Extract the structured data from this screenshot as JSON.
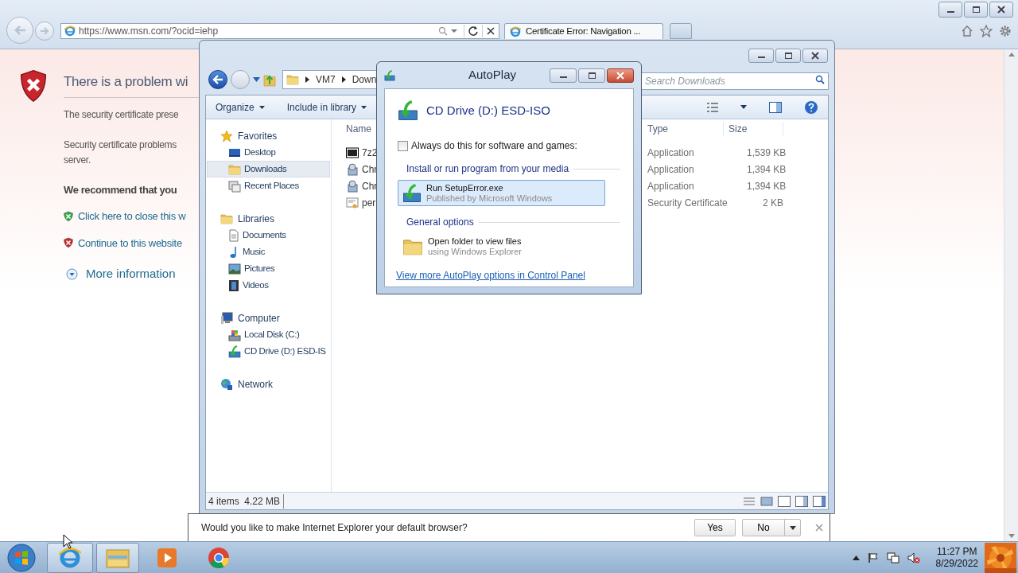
{
  "browser": {
    "address": "https://www.msn.com/?ocid=iehp",
    "tab_title": "Certificate Error: Navigation ...",
    "page": {
      "title": "There is a problem wi",
      "paragraphs": [
        {
          "lines": [
            "The security certificate prese"
          ]
        },
        {
          "lines": [
            "Security certificate problems",
            "server."
          ]
        }
      ],
      "recommend": "We recommend that you",
      "links": [
        {
          "kind": "safe",
          "text": "Click here to close this w"
        },
        {
          "kind": "unsafe",
          "text": "Continue to this website"
        }
      ],
      "more_info": "More information"
    },
    "notification": {
      "message": "Would you like to make Internet Explorer your default browser?",
      "yes": "Yes",
      "no": "No"
    }
  },
  "explorer": {
    "breadcrumb": [
      "VM7",
      "Down"
    ],
    "search_placeholder": "Search Downloads",
    "toolbar": [
      "Organize",
      "Include in library"
    ],
    "nav": [
      {
        "label": "Favorites",
        "children": [
          {
            "label": "Desktop",
            "selected": false
          },
          {
            "label": "Downloads",
            "selected": true
          },
          {
            "label": "Recent Places",
            "selected": false
          }
        ]
      },
      {
        "label": "Libraries",
        "children": [
          {
            "label": "Documents",
            "selected": false
          },
          {
            "label": "Music",
            "selected": false
          },
          {
            "label": "Pictures",
            "selected": false
          },
          {
            "label": "Videos",
            "selected": false
          }
        ]
      },
      {
        "label": "Computer",
        "children": [
          {
            "label": "Local Disk (C:)",
            "selected": false
          },
          {
            "label": "CD Drive (D:) ESD-IS",
            "selected": false
          }
        ]
      },
      {
        "label": "Network"
      }
    ],
    "columns": [
      "Name",
      "Type",
      "Size"
    ],
    "files": [
      {
        "name": "7z2",
        "type": "Application",
        "size": "1,539 KB"
      },
      {
        "name": "Chr",
        "type": "Application",
        "size": "1,394 KB"
      },
      {
        "name": "Chr",
        "type": "Application",
        "size": "1,394 KB"
      },
      {
        "name": "per",
        "type": "Security Certificate",
        "size": "2 KB"
      }
    ],
    "status": "4 items  4.22 MB"
  },
  "autoplay": {
    "title": "AutoPlay",
    "drive": "CD Drive (D:) ESD-ISO",
    "always": {
      "label": "Always do this for software and games:",
      "checked": false
    },
    "sections": [
      {
        "heading": "Install or run program from your media",
        "options": [
          {
            "title": "Run SetupError.exe",
            "subtitle": "Published by Microsoft Windows",
            "selected": true
          }
        ]
      },
      {
        "heading": "General options",
        "options": [
          {
            "title": "Open folder to view files",
            "subtitle": "using Windows Explorer",
            "selected": false
          }
        ]
      }
    ],
    "link": "View more AutoPlay options in Control Panel"
  },
  "taskbar": {
    "time": "11:27 PM",
    "date": "8/29/2022"
  }
}
